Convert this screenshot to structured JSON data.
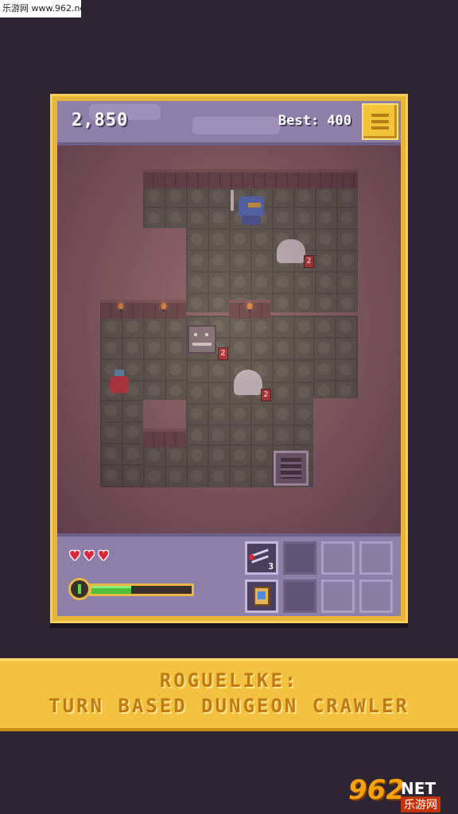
{
  "watermark_top": "乐游网 www.962.net",
  "hud": {
    "score": "2,850",
    "best": "Best: 400",
    "hearts": 3,
    "xp_fill": 0.4
  },
  "map": {
    "enemies": [
      {
        "name": "ghost",
        "level": "2"
      },
      {
        "name": "wolf",
        "level": "2"
      },
      {
        "name": "ghost",
        "level": "2"
      }
    ]
  },
  "inventory": {
    "slot_1_count": "3"
  },
  "banner": {
    "line1": "ROGUELIKE:",
    "line2": "TURN BASED DUNGEON CRAWLER"
  },
  "watermark_bottom": {
    "number": "962",
    "net": "NET",
    "cn": "乐游网"
  },
  "colors": {
    "frame": "#e8b53a",
    "hud": "#8d7fa8",
    "banner": "#f2c140",
    "banner_text": "#c07b16"
  }
}
